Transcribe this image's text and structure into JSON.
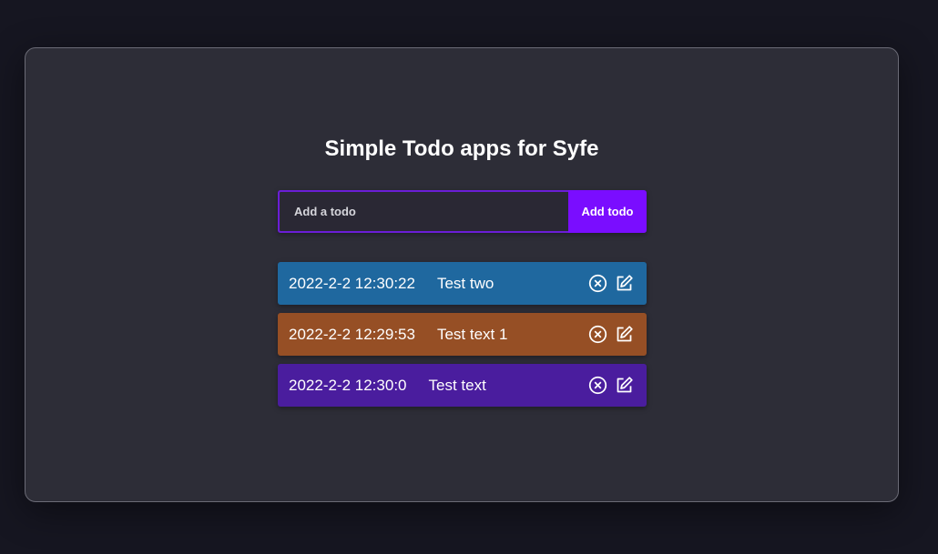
{
  "app": {
    "title": "Simple Todo apps for Syfe"
  },
  "form": {
    "placeholder": "Add a todo",
    "value": "",
    "button_label": "Add todo"
  },
  "colors": {
    "accent": "#7a0dff",
    "input_border": "#6b1ed6"
  },
  "todos": [
    {
      "timestamp": "2022-2-2 12:30:22",
      "text": "Test two",
      "color": "#1f689f",
      "delete_icon": "close-circle-icon",
      "edit_icon": "edit-icon"
    },
    {
      "timestamp": "2022-2-2 12:29:53",
      "text": "Test text 1",
      "color": "#964f25",
      "delete_icon": "close-circle-icon",
      "edit_icon": "edit-icon"
    },
    {
      "timestamp": "2022-2-2 12:30:0",
      "text": "Test text",
      "color": "#4a1d9e",
      "delete_icon": "close-circle-icon",
      "edit_icon": "edit-icon"
    }
  ]
}
